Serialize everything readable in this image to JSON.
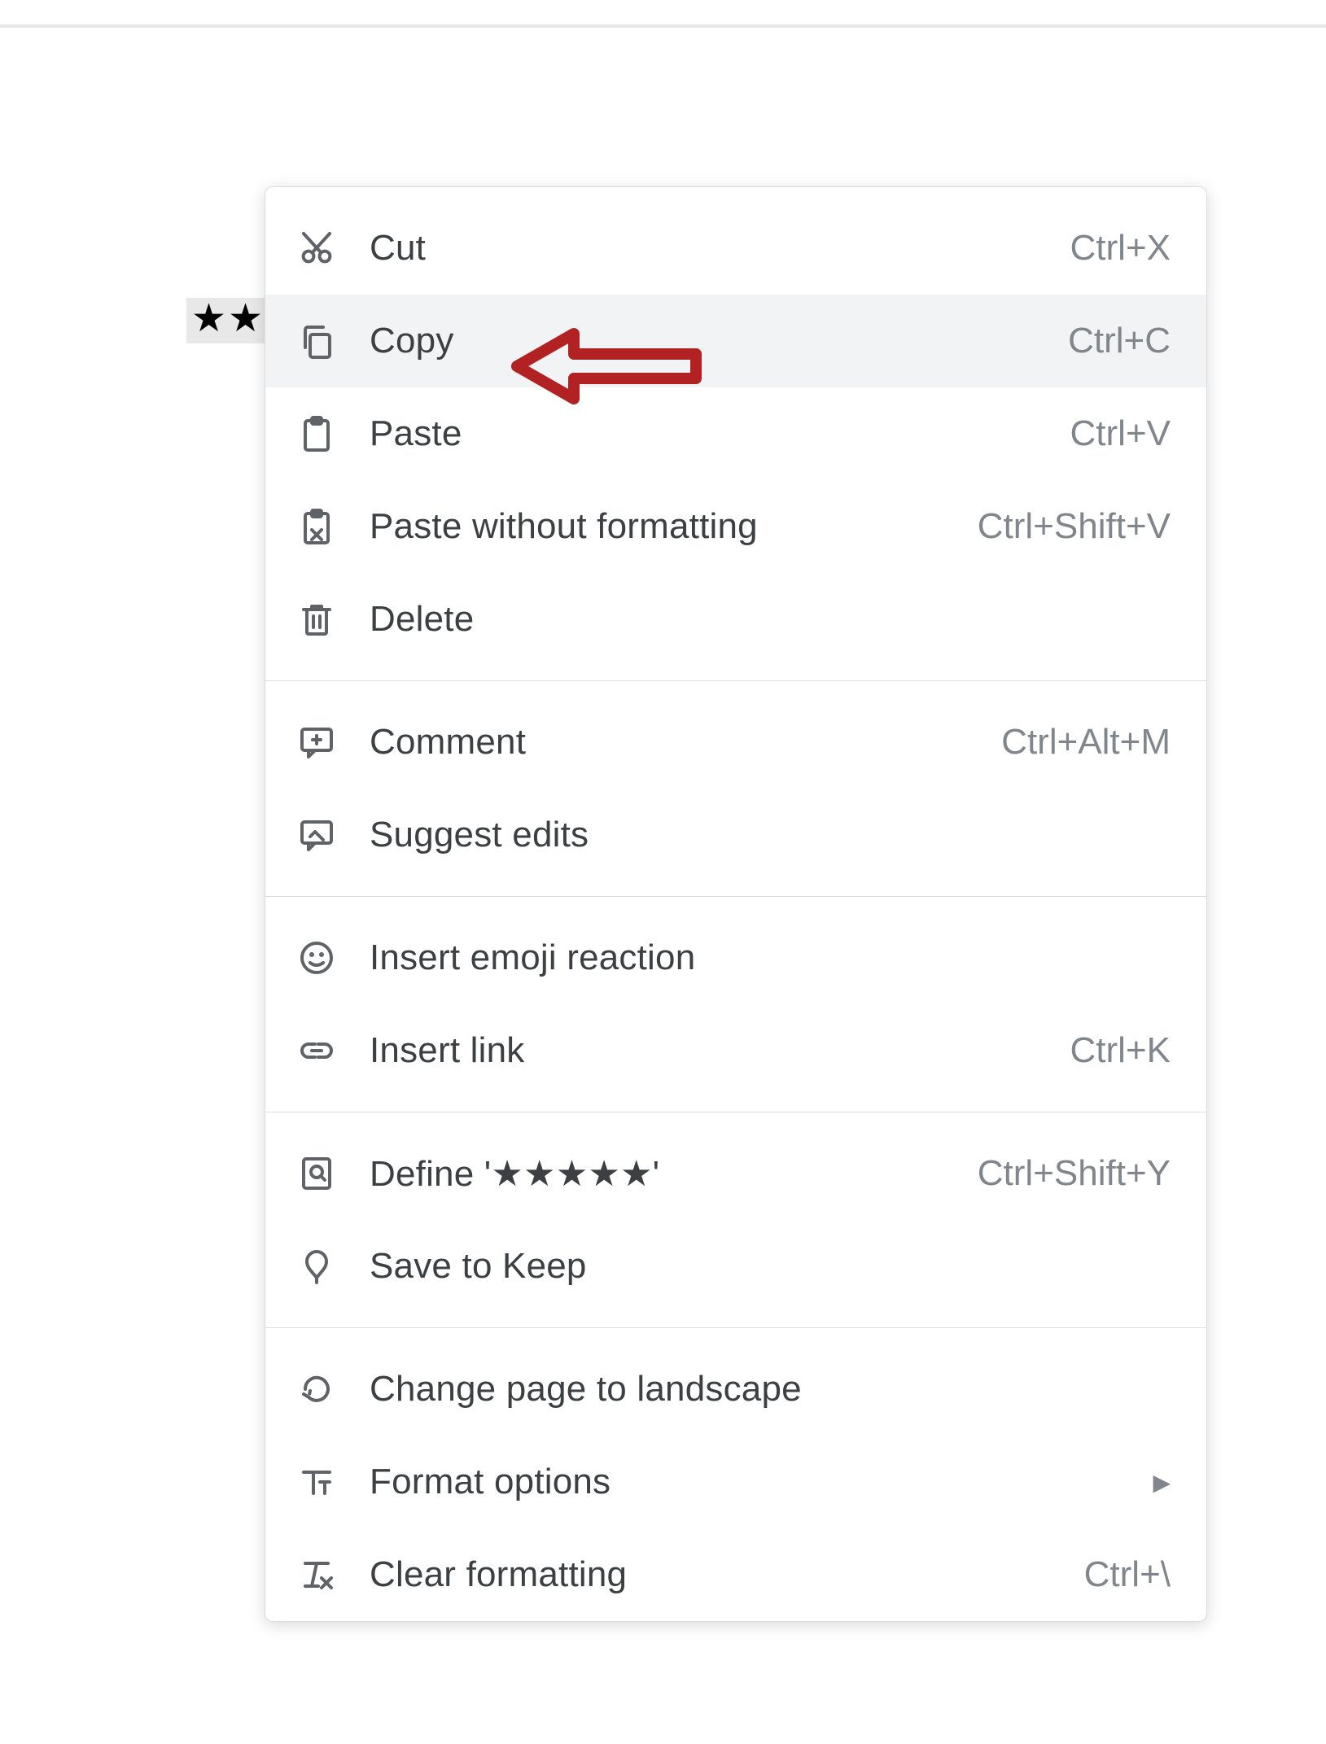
{
  "document": {
    "selected_text_visible": "★★"
  },
  "menu": {
    "items": [
      {
        "icon": "cut-icon",
        "label": "Cut",
        "shortcut": "Ctrl+X",
        "highlighted": false
      },
      {
        "icon": "copy-icon",
        "label": "Copy",
        "shortcut": "Ctrl+C",
        "highlighted": true
      },
      {
        "icon": "paste-icon",
        "label": "Paste",
        "shortcut": "Ctrl+V",
        "highlighted": false
      },
      {
        "icon": "paste-plain-icon",
        "label": "Paste without formatting",
        "shortcut": "Ctrl+Shift+V",
        "highlighted": false
      },
      {
        "icon": "trash-icon",
        "label": "Delete",
        "shortcut": "",
        "highlighted": false
      },
      {
        "divider": true
      },
      {
        "icon": "comment-icon",
        "label": "Comment",
        "shortcut": "Ctrl+Alt+M",
        "highlighted": false
      },
      {
        "icon": "suggest-icon",
        "label": "Suggest edits",
        "shortcut": "",
        "highlighted": false
      },
      {
        "divider": true
      },
      {
        "icon": "emoji-icon",
        "label": "Insert emoji reaction",
        "shortcut": "",
        "highlighted": false
      },
      {
        "icon": "link-icon",
        "label": "Insert link",
        "shortcut": "Ctrl+K",
        "highlighted": false
      },
      {
        "divider": true
      },
      {
        "icon": "define-icon",
        "label": "Define '★★★★★'",
        "shortcut": "Ctrl+Shift+Y",
        "highlighted": false
      },
      {
        "icon": "keep-icon",
        "label": "Save to Keep",
        "shortcut": "",
        "highlighted": false
      },
      {
        "divider": true
      },
      {
        "icon": "rotate-icon",
        "label": "Change page to landscape",
        "shortcut": "",
        "highlighted": false
      },
      {
        "icon": "format-icon",
        "label": "Format options",
        "shortcut": "",
        "submenu": true,
        "highlighted": false
      },
      {
        "icon": "clear-format-icon",
        "label": "Clear formatting",
        "shortcut": "Ctrl+\\",
        "highlighted": false
      }
    ]
  },
  "annotation": {
    "arrow_color": "#b22222",
    "points_to": "Copy"
  }
}
